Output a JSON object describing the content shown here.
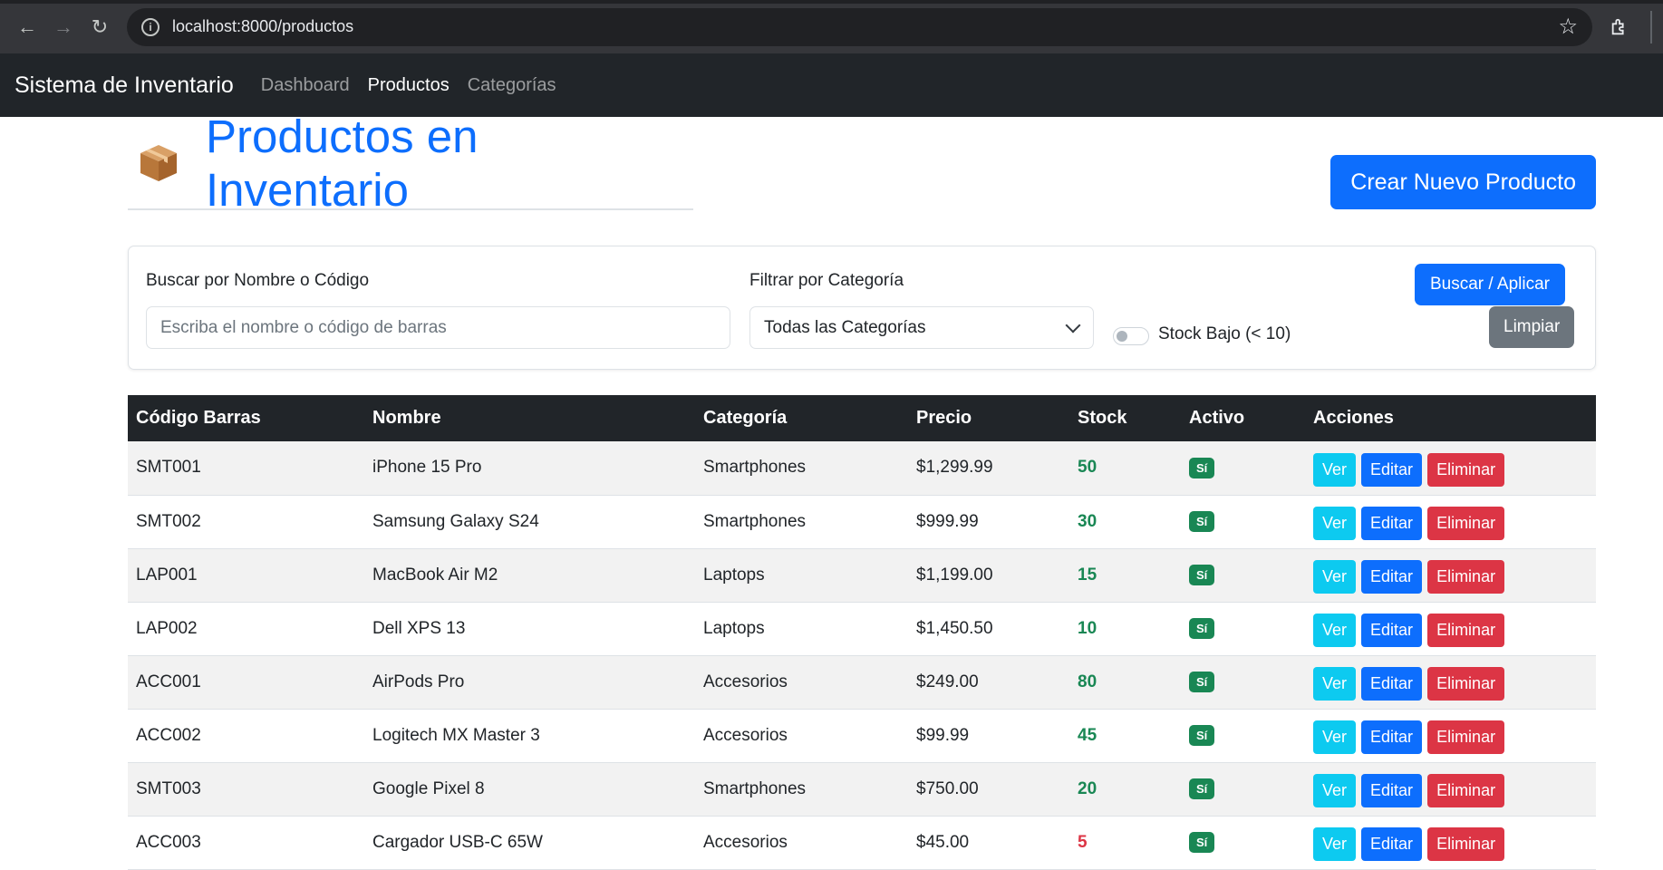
{
  "browser": {
    "url": "localhost:8000/productos"
  },
  "navbar": {
    "brand": "Sistema de Inventario",
    "links": [
      {
        "label": "Dashboard",
        "active": false
      },
      {
        "label": "Productos",
        "active": true
      },
      {
        "label": "Categorías",
        "active": false
      }
    ]
  },
  "page": {
    "title": "Productos en Inventario",
    "create_button": "Crear Nuevo Producto"
  },
  "filters": {
    "search_label": "Buscar por Nombre o Código",
    "search_placeholder": "Escriba el nombre o código de barras",
    "category_label": "Filtrar por Categoría",
    "category_selected": "Todas las Categorías",
    "low_stock_label": "Stock Bajo (< 10)",
    "search_button": "Buscar / Aplicar",
    "clear_button": "Limpiar"
  },
  "table": {
    "headers": [
      "Código Barras",
      "Nombre",
      "Categoría",
      "Precio",
      "Stock",
      "Activo",
      "Acciones"
    ],
    "action_labels": {
      "view": "Ver",
      "edit": "Editar",
      "delete": "Eliminar"
    },
    "rows": [
      {
        "code": "SMT001",
        "name": "iPhone 15 Pro",
        "category": "Smartphones",
        "price": "$1,299.99",
        "stock": "50",
        "active": "Sí",
        "low": false
      },
      {
        "code": "SMT002",
        "name": "Samsung Galaxy S24",
        "category": "Smartphones",
        "price": "$999.99",
        "stock": "30",
        "active": "Sí",
        "low": false
      },
      {
        "code": "LAP001",
        "name": "MacBook Air M2",
        "category": "Laptops",
        "price": "$1,199.00",
        "stock": "15",
        "active": "Sí",
        "low": false
      },
      {
        "code": "LAP002",
        "name": "Dell XPS 13",
        "category": "Laptops",
        "price": "$1,450.50",
        "stock": "10",
        "active": "Sí",
        "low": false
      },
      {
        "code": "ACC001",
        "name": "AirPods Pro",
        "category": "Accesorios",
        "price": "$249.00",
        "stock": "80",
        "active": "Sí",
        "low": false
      },
      {
        "code": "ACC002",
        "name": "Logitech MX Master 3",
        "category": "Accesorios",
        "price": "$99.99",
        "stock": "45",
        "active": "Sí",
        "low": false
      },
      {
        "code": "SMT003",
        "name": "Google Pixel 8",
        "category": "Smartphones",
        "price": "$750.00",
        "stock": "20",
        "active": "Sí",
        "low": false
      },
      {
        "code": "ACC003",
        "name": "Cargador USB-C 65W",
        "category": "Accesorios",
        "price": "$45.00",
        "stock": "5",
        "active": "Sí",
        "low": true
      }
    ]
  }
}
